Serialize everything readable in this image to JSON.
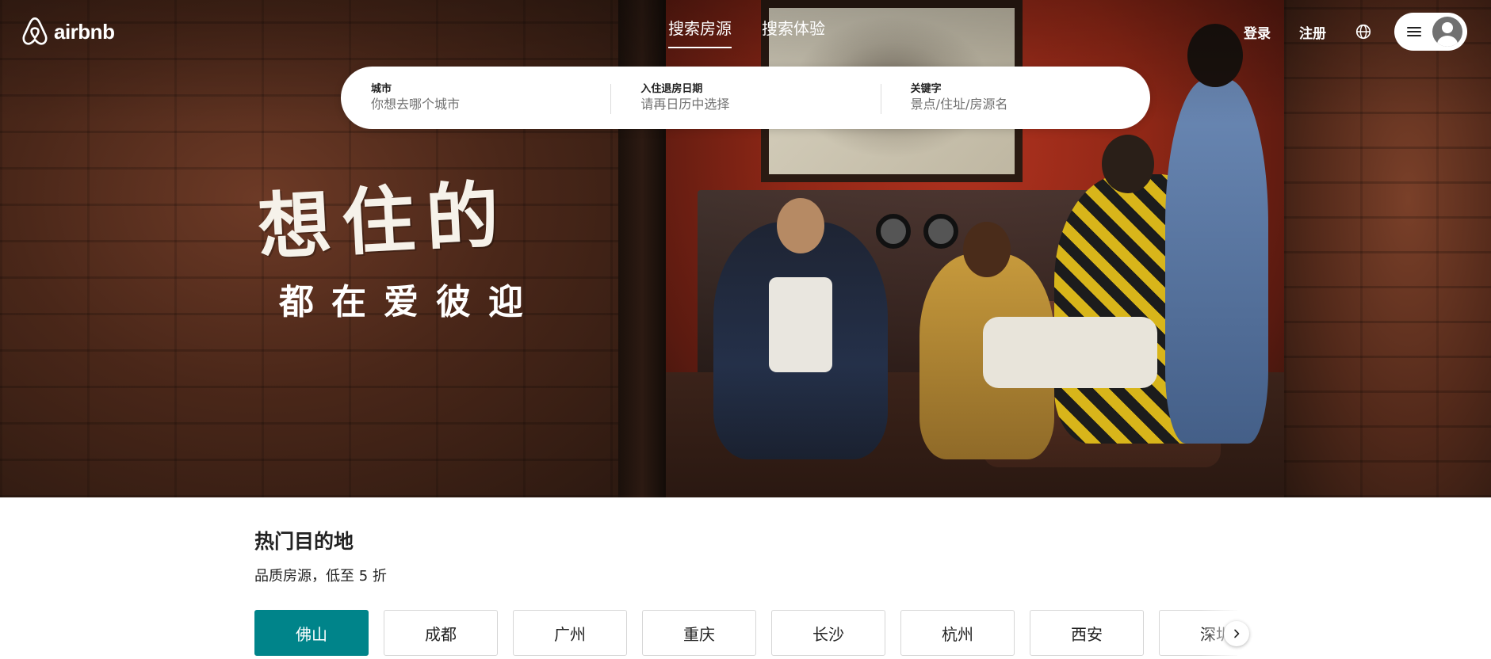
{
  "brand": {
    "name": "airbnb",
    "logo_icon": "airbnb-belo-icon"
  },
  "nav": {
    "tabs": [
      {
        "label": "搜索房源",
        "active": true
      },
      {
        "label": "搜索体验",
        "active": false
      }
    ],
    "login": "登录",
    "signup": "注册",
    "globe_icon": "globe-icon",
    "menu_icon": "hamburger-icon",
    "avatar_icon": "user-avatar-icon"
  },
  "search": {
    "city": {
      "label": "城市",
      "placeholder": "你想去哪个城市"
    },
    "dates": {
      "label": "入住退房日期",
      "placeholder": "请再日历中选择"
    },
    "keyword": {
      "label": "关键字",
      "placeholder": "景点/住址/房源名"
    }
  },
  "hero": {
    "headline": "想住的",
    "subline": "都在爱彼迎"
  },
  "destinations": {
    "title": "热门目的地",
    "subtitle": "品质房源，低至 5 折",
    "cities": [
      "佛山",
      "成都",
      "广州",
      "重庆",
      "长沙",
      "杭州",
      "西安",
      "深圳"
    ],
    "active_index": 0,
    "next_icon": "chevron-right-icon"
  },
  "colors": {
    "accent": "#00848a",
    "text": "#222222",
    "muted": "#717171"
  }
}
